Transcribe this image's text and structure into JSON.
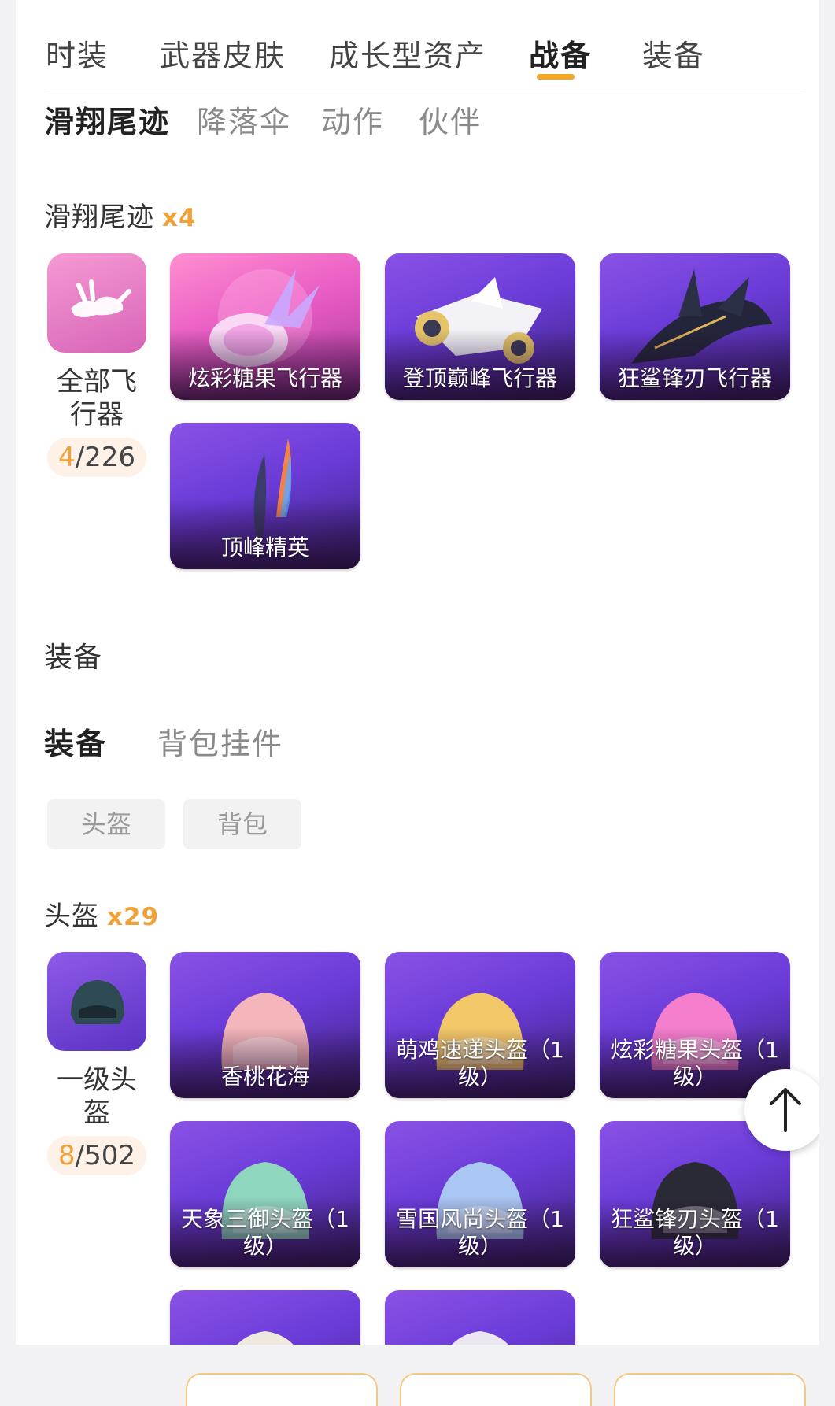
{
  "top_tabs": [
    {
      "label": "时装",
      "active": false
    },
    {
      "label": "武器皮肤",
      "active": false
    },
    {
      "label": "成长型资产",
      "active": false
    },
    {
      "label": "战备",
      "active": true
    },
    {
      "label": "装备",
      "active": false
    }
  ],
  "sub_tabs": [
    {
      "label": "滑翔尾迹",
      "active": true
    },
    {
      "label": "降落伞",
      "active": false
    },
    {
      "label": "动作",
      "active": false
    },
    {
      "label": "伙伴",
      "active": false
    }
  ],
  "glide": {
    "title": "滑翔尾迹",
    "count": "x4",
    "category": {
      "label": "全部飞行器",
      "owned": "4",
      "total": "/226",
      "icon": "skydiver-icon"
    },
    "items": [
      {
        "name": "炫彩糖果飞行器",
        "icon": "candy-glider-icon"
      },
      {
        "name": "登顶巅峰飞行器",
        "icon": "jet-glider-icon"
      },
      {
        "name": "狂鲨锋刃飞行器",
        "icon": "shark-glider-icon"
      },
      {
        "name": "顶峰精英",
        "icon": "flame-trail-icon"
      }
    ]
  },
  "equipment": {
    "section_title": "装备",
    "tabs": [
      {
        "label": "装备",
        "active": true
      },
      {
        "label": "背包挂件",
        "active": false
      }
    ],
    "chips": [
      "头盔",
      "背包"
    ],
    "helmets": {
      "title": "头盔",
      "count": "x29",
      "category": {
        "label": "一级头盔",
        "owned": "8",
        "total": "/502",
        "icon": "helmet-icon"
      },
      "items": [
        {
          "name": "香桃花海",
          "color": "#f4b6bb"
        },
        {
          "name": "萌鸡速递头盔（1级）",
          "color": "#f3c868"
        },
        {
          "name": "炫彩糖果头盔（1级）",
          "color": "#f57fcd"
        },
        {
          "name": "天象三御头盔（1级）",
          "color": "#8fd6bf"
        },
        {
          "name": "雪国风尚头盔（1级）",
          "color": "#a9c7f2"
        },
        {
          "name": "狂鲨锋刃头盔（1级）",
          "color": "#2a2a36"
        },
        {
          "name": "",
          "color": "#efe8df"
        },
        {
          "name": "",
          "color": "#ece6f0"
        }
      ]
    }
  },
  "colors": {
    "accent": "#f5a623",
    "card": "#6a3bd8"
  },
  "fab_icon": "arrow-up-icon"
}
